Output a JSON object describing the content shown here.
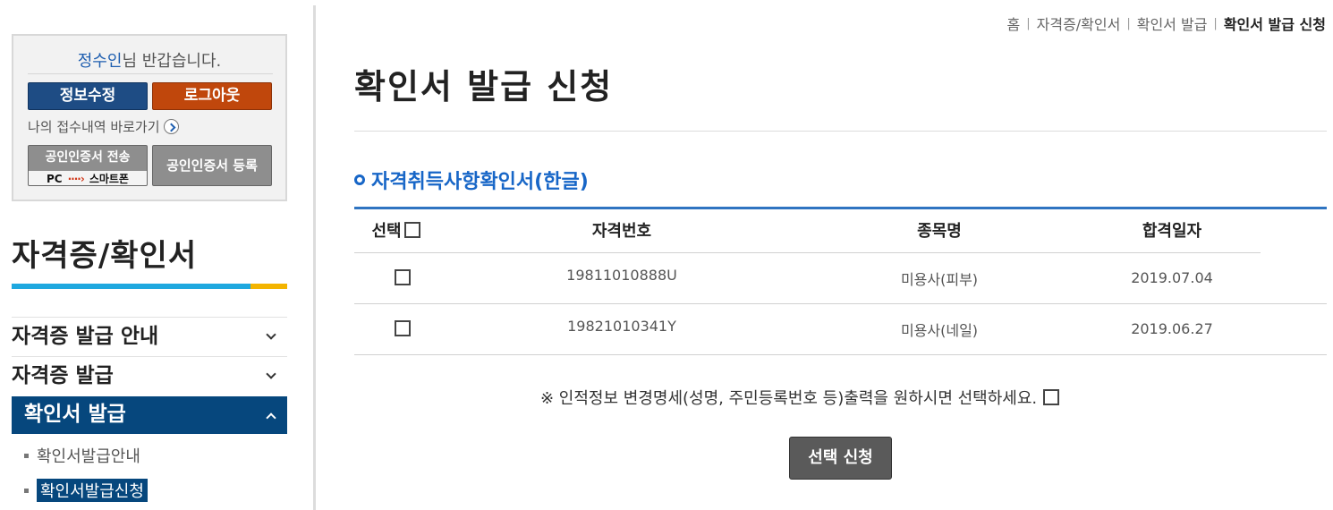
{
  "user": {
    "name": "정수인",
    "greeting_suffix": "님 반갑습니다.",
    "edit_label": "정보수정",
    "logout_label": "로그아웃",
    "receipt_link": "나의 접수내역 바로가기",
    "cert_transfer_label": "공인인증서 전송",
    "cert_transfer_from": "PC",
    "cert_transfer_to": "스마트폰",
    "cert_register_label": "공인인증서 등록"
  },
  "sidebar": {
    "title": "자격증/확인서",
    "menu": [
      {
        "label": "자격증 발급 안내",
        "expanded": false
      },
      {
        "label": "자격증 발급",
        "expanded": false
      },
      {
        "label": "확인서 발급",
        "expanded": true
      }
    ],
    "submenu": [
      {
        "label": "확인서발급안내",
        "active": false
      },
      {
        "label": "확인서발급신청",
        "active": true
      }
    ]
  },
  "breadcrumb": [
    "홈",
    "자격증/확인서",
    "확인서 발급",
    "확인서 발급 신청"
  ],
  "main": {
    "title": "확인서 발급 신청",
    "section_title": "자격취득사항확인서(한글)",
    "table": {
      "headers": [
        "선택",
        "자격번호",
        "종목명",
        "합격일자"
      ],
      "rows": [
        {
          "number": "19811010888U",
          "name": "미용사(피부)",
          "date": "2019.07.04"
        },
        {
          "number": "19821010341Y",
          "name": "미용사(네일)",
          "date": "2019.06.27"
        }
      ]
    },
    "notice": "※ 인적정보 변경명세(성명, 주민등록번호 등)출력을 원하시면 선택하세요.",
    "submit_label": "선택 신청"
  },
  "colors": {
    "navy": "#06477d",
    "logout_orange": "#c0470c",
    "accent_blue": "#1766c7",
    "bar_blue": "#1fa8df",
    "bar_yellow": "#f3b400"
  }
}
